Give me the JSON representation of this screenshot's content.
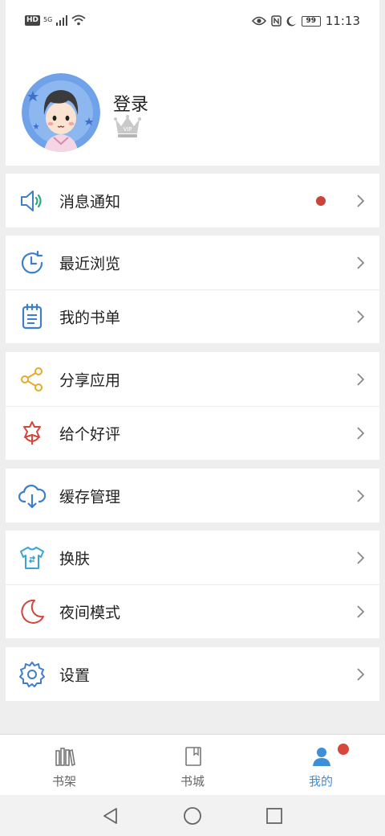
{
  "status_bar": {
    "left_badge": "HD",
    "network": "5G",
    "time": "11:13",
    "battery": "99",
    "icons": [
      "eye-icon",
      "nfc-icon",
      "moon-icon",
      "battery-icon"
    ]
  },
  "profile": {
    "login_label": "登录",
    "vip_badge": "VIP"
  },
  "menu": {
    "notifications": {
      "label": "消息通知",
      "icon": "speaker-icon",
      "has_unread": true
    },
    "recent": {
      "label": "最近浏览",
      "icon": "clock-icon"
    },
    "booklist": {
      "label": "我的书单",
      "icon": "notepad-icon"
    },
    "share": {
      "label": "分享应用",
      "icon": "share-icon"
    },
    "rate": {
      "label": "给个好评",
      "icon": "flower-icon"
    },
    "cache": {
      "label": "缓存管理",
      "icon": "cloud-download-icon"
    },
    "skin": {
      "label": "换肤",
      "icon": "tshirt-icon"
    },
    "night": {
      "label": "夜间模式",
      "icon": "moon-icon"
    },
    "settings": {
      "label": "设置",
      "icon": "gear-icon"
    }
  },
  "tabs": [
    {
      "label": "书架",
      "icon": "bookshelf-icon",
      "active": false
    },
    {
      "label": "书城",
      "icon": "book-icon",
      "active": false
    },
    {
      "label": "我的",
      "icon": "person-icon",
      "active": true
    }
  ],
  "colors": {
    "accent": "#3f8fd8",
    "badge_red": "#c9443a",
    "background": "#eeeeee"
  }
}
